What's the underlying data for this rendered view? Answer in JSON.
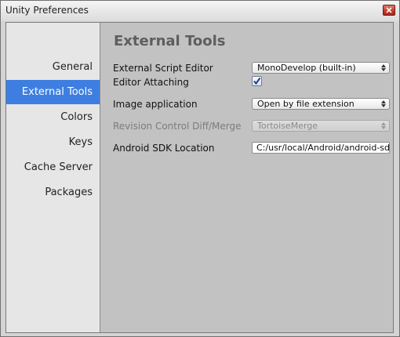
{
  "window": {
    "title": "Unity Preferences"
  },
  "sidebar": {
    "items": [
      {
        "label": "General"
      },
      {
        "label": "External Tools"
      },
      {
        "label": "Colors"
      },
      {
        "label": "Keys"
      },
      {
        "label": "Cache Server"
      },
      {
        "label": "Packages"
      }
    ],
    "selected": "External Tools"
  },
  "main": {
    "section_title": "External Tools",
    "settings": {
      "script_editor": {
        "label": "External Script Editor",
        "value": "MonoDevelop (built-in)"
      },
      "editor_attaching": {
        "label": "Editor Attaching",
        "checked": true
      },
      "image_application": {
        "label": "Image application",
        "value": "Open by file extension"
      },
      "revision_control": {
        "label": "Revision Control Diff/Merge",
        "value": "TortoiseMerge",
        "disabled": true
      },
      "android_sdk": {
        "label": "Android SDK Location",
        "value": "C:/usr/local/Android/android-sdk"
      }
    }
  },
  "colors": {
    "selection": "#3e7ee0",
    "sidebar_bg": "#e6e6e6",
    "content_bg": "#c2c2c2",
    "close_button": "#c0392b"
  },
  "icons": {
    "close": "close-icon",
    "dropdown": "updown-arrows-icon",
    "checkmark": "checkmark-icon"
  }
}
